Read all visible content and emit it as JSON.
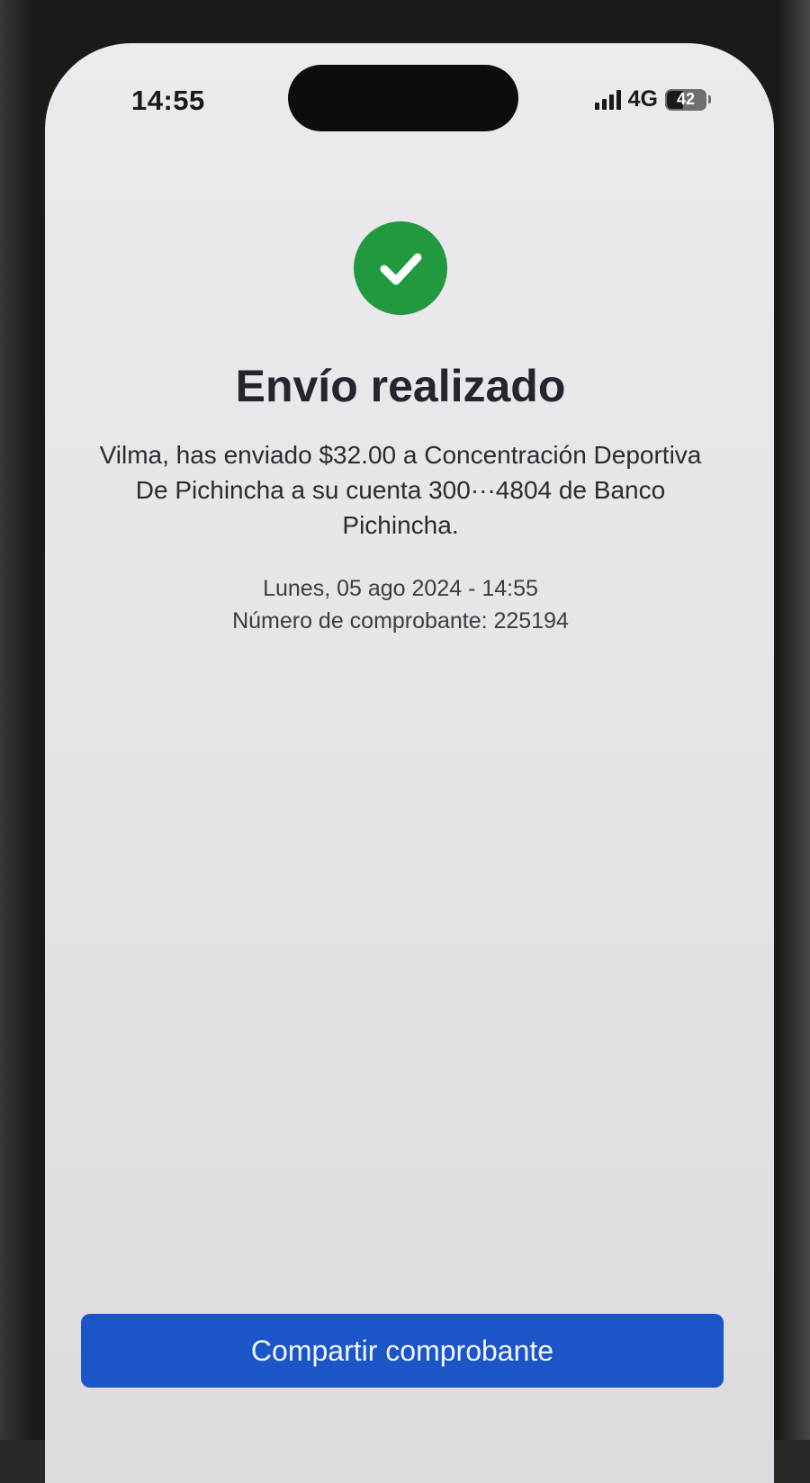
{
  "status_bar": {
    "time": "14:55",
    "network": "4G",
    "battery_level": "42",
    "signal_icon": "signal-bars-icon",
    "battery_icon": "battery-icon"
  },
  "success": {
    "icon": "check-circle-icon",
    "icon_color": "#22993f"
  },
  "headline": "Envío realizado",
  "message": "Vilma, has enviado $32.00 a Concentración Deportiva De Pichincha a su cuenta 300···4804 de Banco Pichincha.",
  "meta": {
    "date": "Lunes, 05 ago 2024 - 14:55",
    "receipt": "Número de comprobante: 225194"
  },
  "actions": {
    "share_label": "Compartir comprobante",
    "share_color": "#1a56c8"
  }
}
